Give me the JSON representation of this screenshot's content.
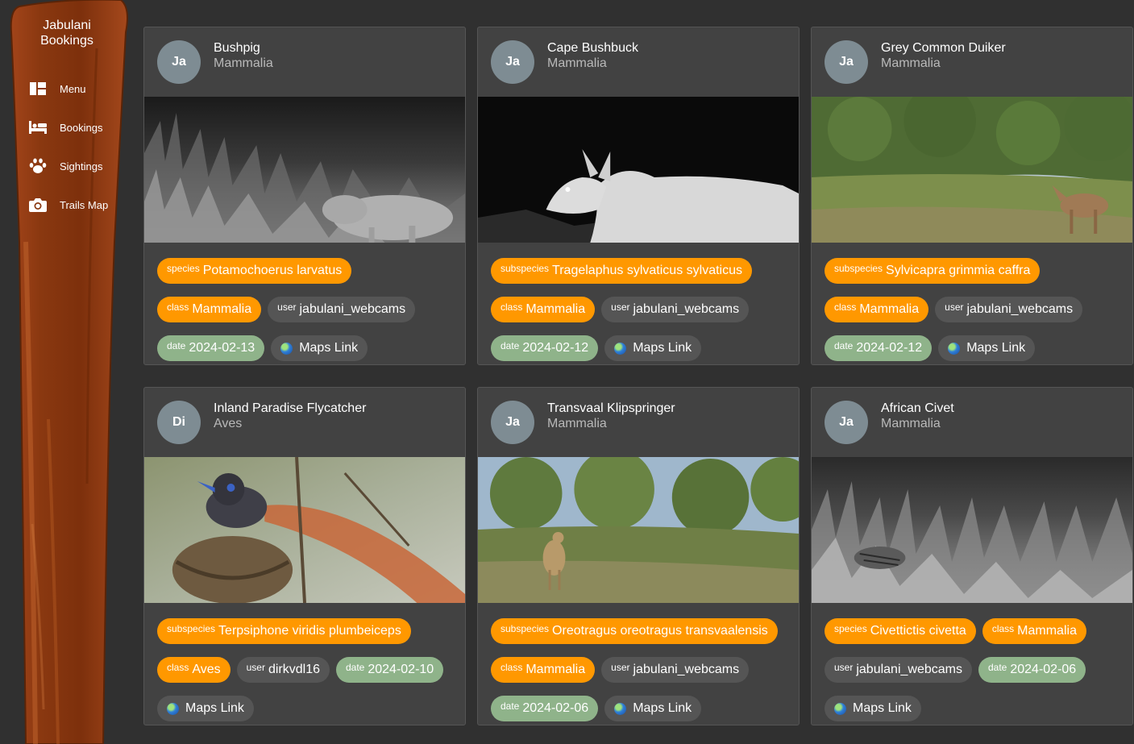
{
  "sidebar": {
    "brand": "Jabulani\nBookings",
    "items": [
      {
        "label": "Menu",
        "icon": "dashboard-icon"
      },
      {
        "label": "Bookings",
        "icon": "bed-icon"
      },
      {
        "label": "Sightings",
        "icon": "paw-icon"
      },
      {
        "label": "Trails Map",
        "icon": "camera-icon"
      }
    ]
  },
  "cards": [
    {
      "avatar": "Ja",
      "title": "Bushpig",
      "subtitle": "Mammalia",
      "taxon_label": "species",
      "taxon_value": "Potamochoerus larvatus",
      "class_label": "class",
      "class_value": "Mammalia",
      "user_label": "user",
      "user_value": "jabulani_webcams",
      "date_label": "date",
      "date_value": "2024-02-13",
      "maps_label": "Maps Link"
    },
    {
      "avatar": "Ja",
      "title": "Cape Bushbuck",
      "subtitle": "Mammalia",
      "taxon_label": "subspecies",
      "taxon_value": "Tragelaphus sylvaticus sylvaticus",
      "class_label": "class",
      "class_value": "Mammalia",
      "user_label": "user",
      "user_value": "jabulani_webcams",
      "date_label": "date",
      "date_value": "2024-02-12",
      "maps_label": "Maps Link"
    },
    {
      "avatar": "Ja",
      "title": "Grey Common Duiker",
      "subtitle": "Mammalia",
      "taxon_label": "subspecies",
      "taxon_value": "Sylvicapra grimmia caffra",
      "class_label": "class",
      "class_value": "Mammalia",
      "user_label": "user",
      "user_value": "jabulani_webcams",
      "date_label": "date",
      "date_value": "2024-02-12",
      "maps_label": "Maps Link"
    },
    {
      "avatar": "Di",
      "title": "Inland Paradise Flycatcher",
      "subtitle": "Aves",
      "taxon_label": "subspecies",
      "taxon_value": "Terpsiphone viridis plumbeiceps",
      "class_label": "class",
      "class_value": "Aves",
      "user_label": "user",
      "user_value": "dirkvdl16",
      "date_label": "date",
      "date_value": "2024-02-10",
      "maps_label": "Maps Link"
    },
    {
      "avatar": "Ja",
      "title": "Transvaal Klipspringer",
      "subtitle": "Mammalia",
      "taxon_label": "subspecies",
      "taxon_value": "Oreotragus oreotragus transvaalensis",
      "class_label": "class",
      "class_value": "Mammalia",
      "user_label": "user",
      "user_value": "jabulani_webcams",
      "date_label": "date",
      "date_value": "2024-02-06",
      "maps_label": "Maps Link"
    },
    {
      "avatar": "Ja",
      "title": "African Civet",
      "subtitle": "Mammalia",
      "taxon_label": "species",
      "taxon_value": "Civettictis civetta",
      "class_label": "class",
      "class_value": "Mammalia",
      "user_label": "user",
      "user_value": "jabulani_webcams",
      "date_label": "date",
      "date_value": "2024-02-06",
      "maps_label": "Maps Link"
    }
  ],
  "colors": {
    "background": "#303030",
    "card": "#424242",
    "chip_orange": "#ff9800",
    "chip_grey": "#555555",
    "chip_green": "#8fb38a",
    "avatar": "#7e8c93",
    "plank": "#8b3a0f"
  }
}
